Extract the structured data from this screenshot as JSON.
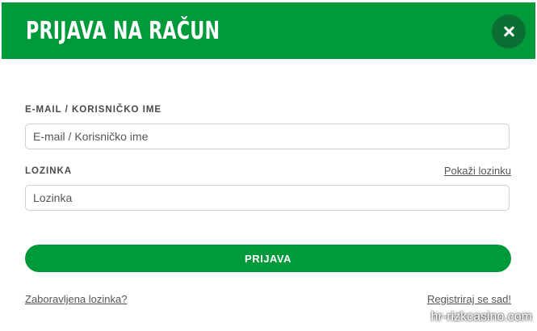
{
  "header": {
    "title": "PRIJAVA NA RAČUN",
    "close_icon": "close-icon",
    "background_color": "#009a3a",
    "close_button_color": "#0b6f33"
  },
  "form": {
    "email_label": "E-MAIL / KORISNIČKO IME",
    "email_placeholder": "E-mail / Korisničko ime",
    "password_label": "LOZINKA",
    "show_password_link": "Pokaži lozinku",
    "password_placeholder": "Lozinka",
    "submit_label": "PRIJAVA"
  },
  "footer": {
    "forgot_password_link": "Zaboravljena lozinka?",
    "register_link": "Registriraj se sad!"
  },
  "watermark": "hr-rizkcasino.com",
  "colors": {
    "accent": "#009a3a"
  }
}
